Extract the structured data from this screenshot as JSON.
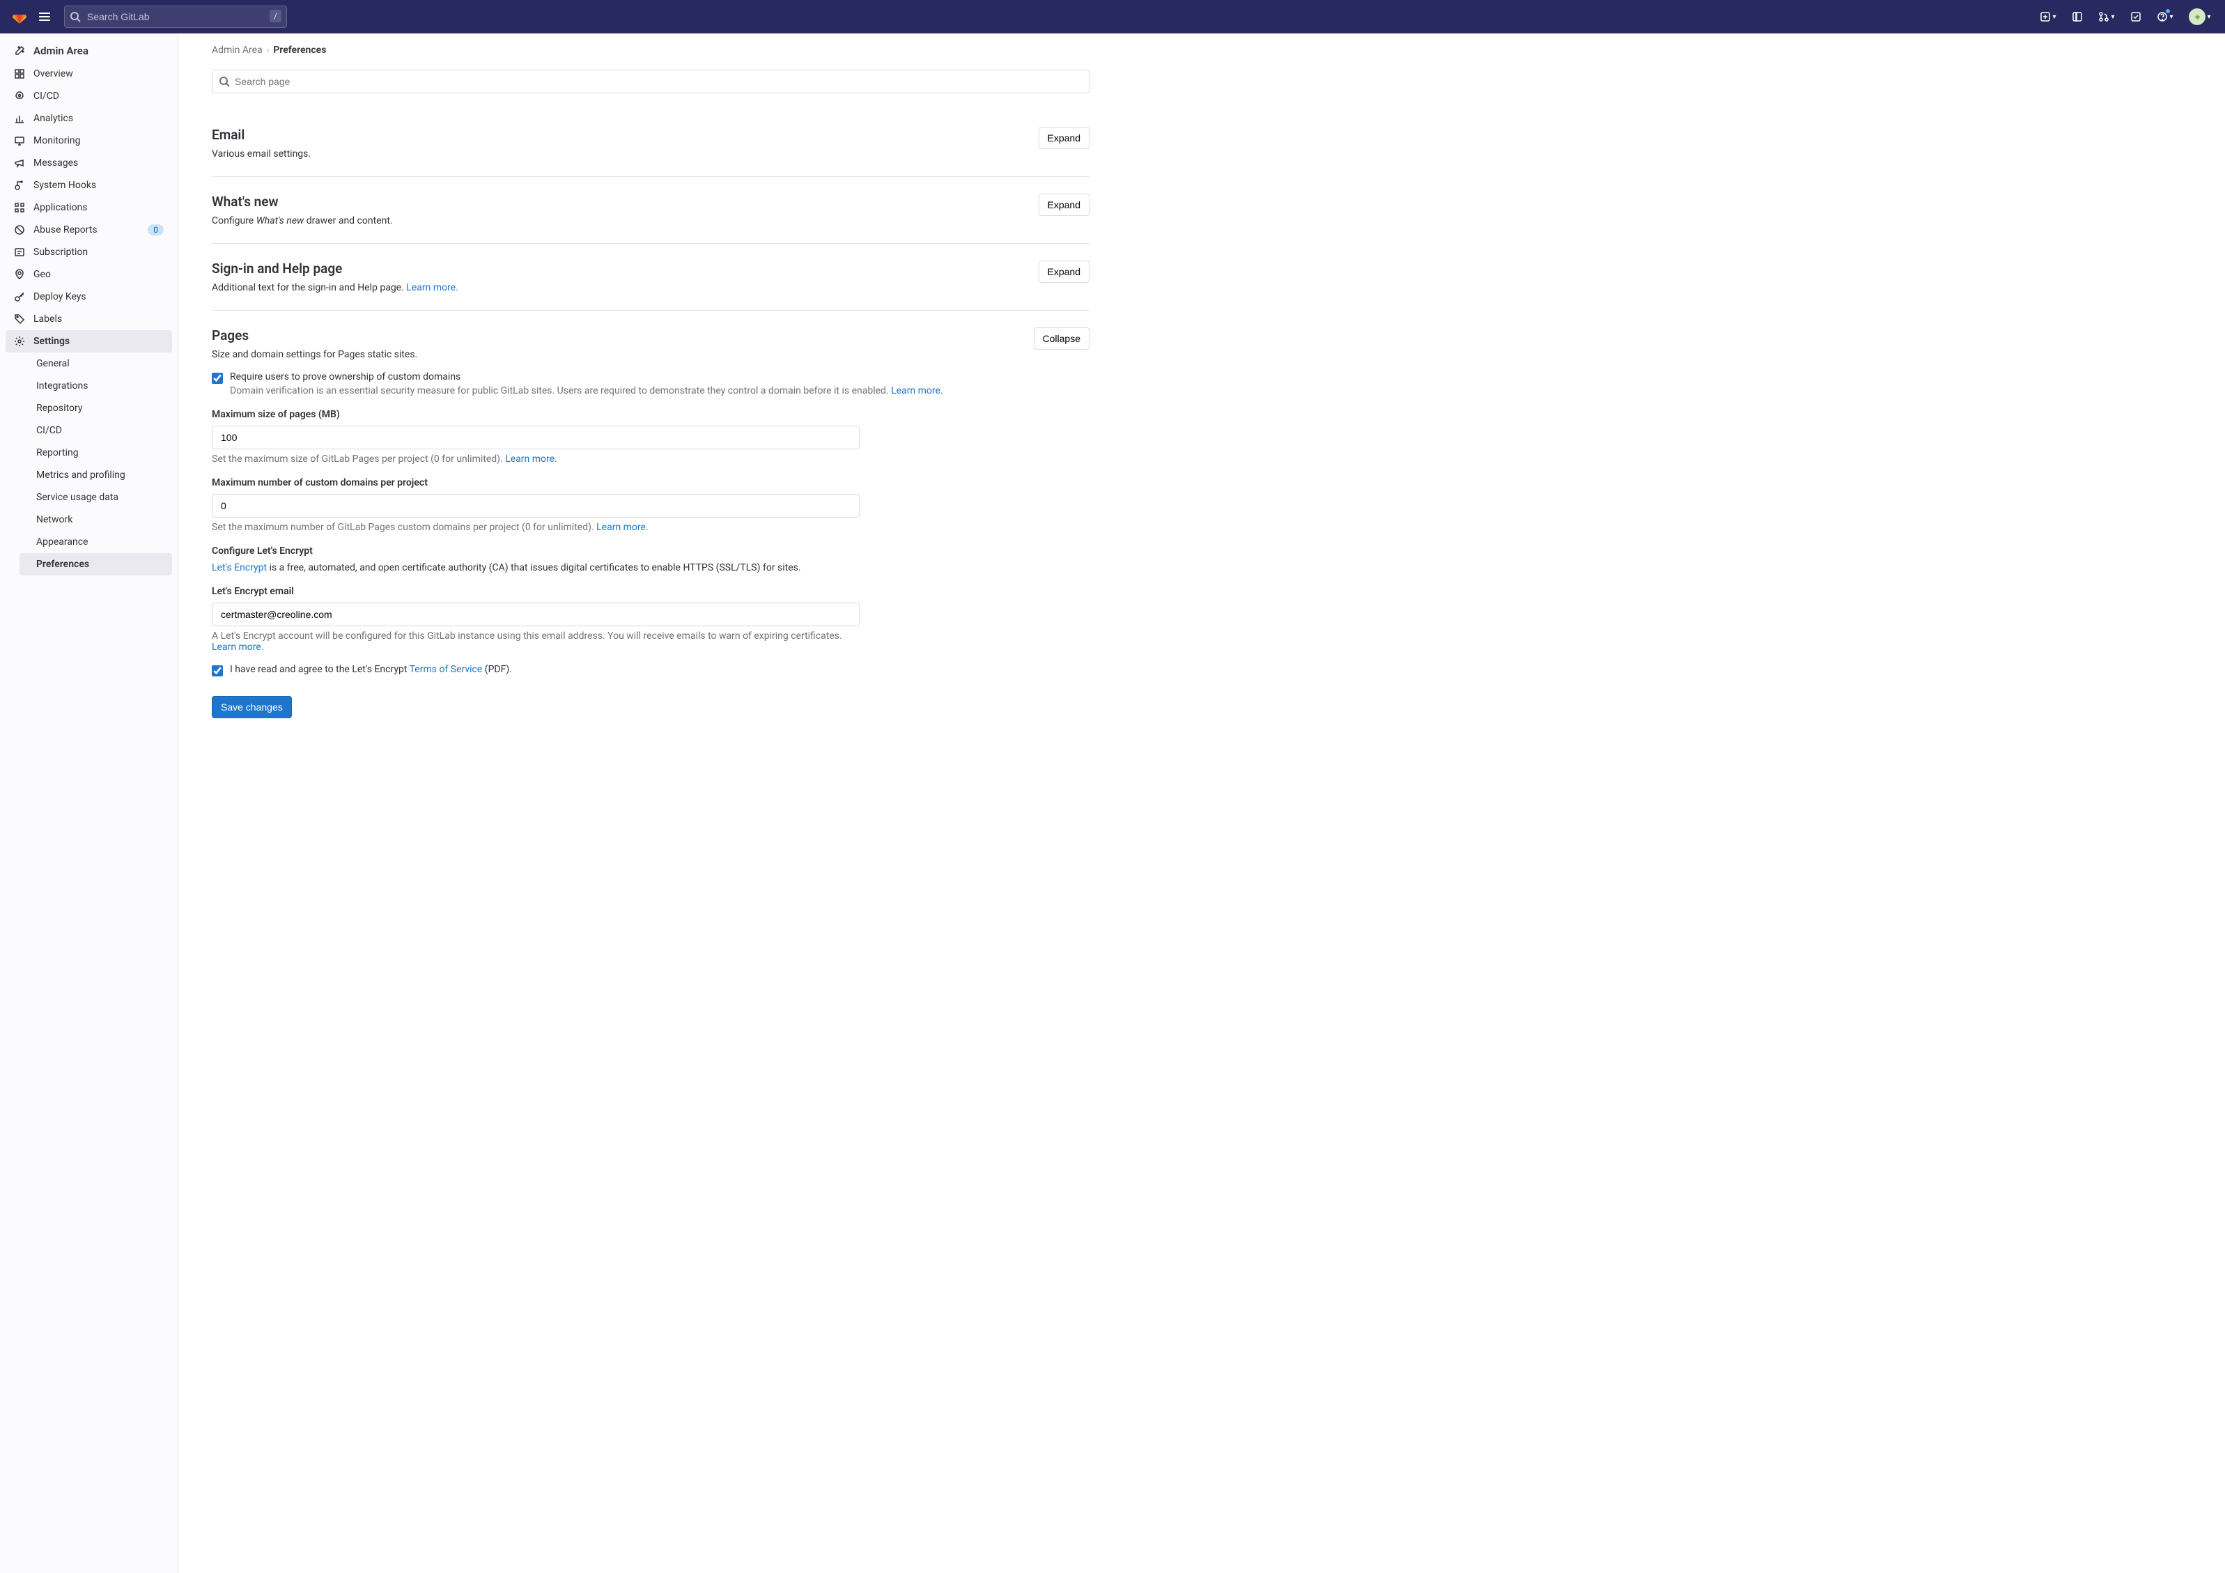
{
  "header": {
    "search_placeholder": "Search GitLab",
    "keyboard_shortcut": "/"
  },
  "sidebar": {
    "title": "Admin Area",
    "items": [
      {
        "label": "Overview"
      },
      {
        "label": "CI/CD"
      },
      {
        "label": "Analytics"
      },
      {
        "label": "Monitoring"
      },
      {
        "label": "Messages"
      },
      {
        "label": "System Hooks"
      },
      {
        "label": "Applications"
      },
      {
        "label": "Abuse Reports",
        "badge": "0"
      },
      {
        "label": "Subscription"
      },
      {
        "label": "Geo"
      },
      {
        "label": "Deploy Keys"
      },
      {
        "label": "Labels"
      },
      {
        "label": "Settings",
        "active": true
      }
    ],
    "settings_sub": [
      {
        "label": "General"
      },
      {
        "label": "Integrations"
      },
      {
        "label": "Repository"
      },
      {
        "label": "CI/CD"
      },
      {
        "label": "Reporting"
      },
      {
        "label": "Metrics and profiling"
      },
      {
        "label": "Service usage data"
      },
      {
        "label": "Network"
      },
      {
        "label": "Appearance"
      },
      {
        "label": "Preferences",
        "active": true
      }
    ]
  },
  "breadcrumb": {
    "parent": "Admin Area",
    "current": "Preferences"
  },
  "page_search_placeholder": "Search page",
  "sections": {
    "email": {
      "title": "Email",
      "desc": "Various email settings.",
      "btn": "Expand"
    },
    "whatsnew": {
      "title": "What's new",
      "desc_pre": "Configure ",
      "desc_em": "What's new",
      "desc_post": " drawer and content.",
      "btn": "Expand"
    },
    "signin": {
      "title": "Sign-in and Help page",
      "desc": "Additional text for the sign-in and Help page. ",
      "learn": "Learn more.",
      "btn": "Expand"
    },
    "pages": {
      "title": "Pages",
      "desc": "Size and domain settings for Pages static sites.",
      "btn": "Collapse",
      "cb1_label": "Require users to prove ownership of custom domains",
      "cb1_help": "Domain verification is an essential security measure for public GitLab sites. Users are required to demonstrate they control a domain before it is enabled. ",
      "cb1_learn": "Learn more.",
      "max_size_label": "Maximum size of pages (MB)",
      "max_size_value": "100",
      "max_size_help": "Set the maximum size of GitLab Pages per project (0 for unlimited). ",
      "max_size_learn": "Learn more.",
      "max_domains_label": "Maximum number of custom domains per project",
      "max_domains_value": "0",
      "max_domains_help": "Set the maximum number of GitLab Pages custom domains per project (0 for unlimited). ",
      "max_domains_learn": "Learn more.",
      "configure_le": "Configure Let's Encrypt",
      "le_link": "Let's Encrypt",
      "le_desc": " is a free, automated, and open certificate authority (CA) that issues digital certificates to enable HTTPS (SSL/TLS) for sites.",
      "le_email_label": "Let's Encrypt email",
      "le_email_value": "certmaster@creoline.com",
      "le_email_help": "A Let's Encrypt account will be configured for this GitLab instance using this email address. You will receive emails to warn of expiring certificates. ",
      "le_email_learn": "Learn more.",
      "cb2_pre": "I have read and agree to the Let's Encrypt ",
      "cb2_link": "Terms of Service",
      "cb2_post": " (PDF).",
      "save_btn": "Save changes"
    }
  }
}
